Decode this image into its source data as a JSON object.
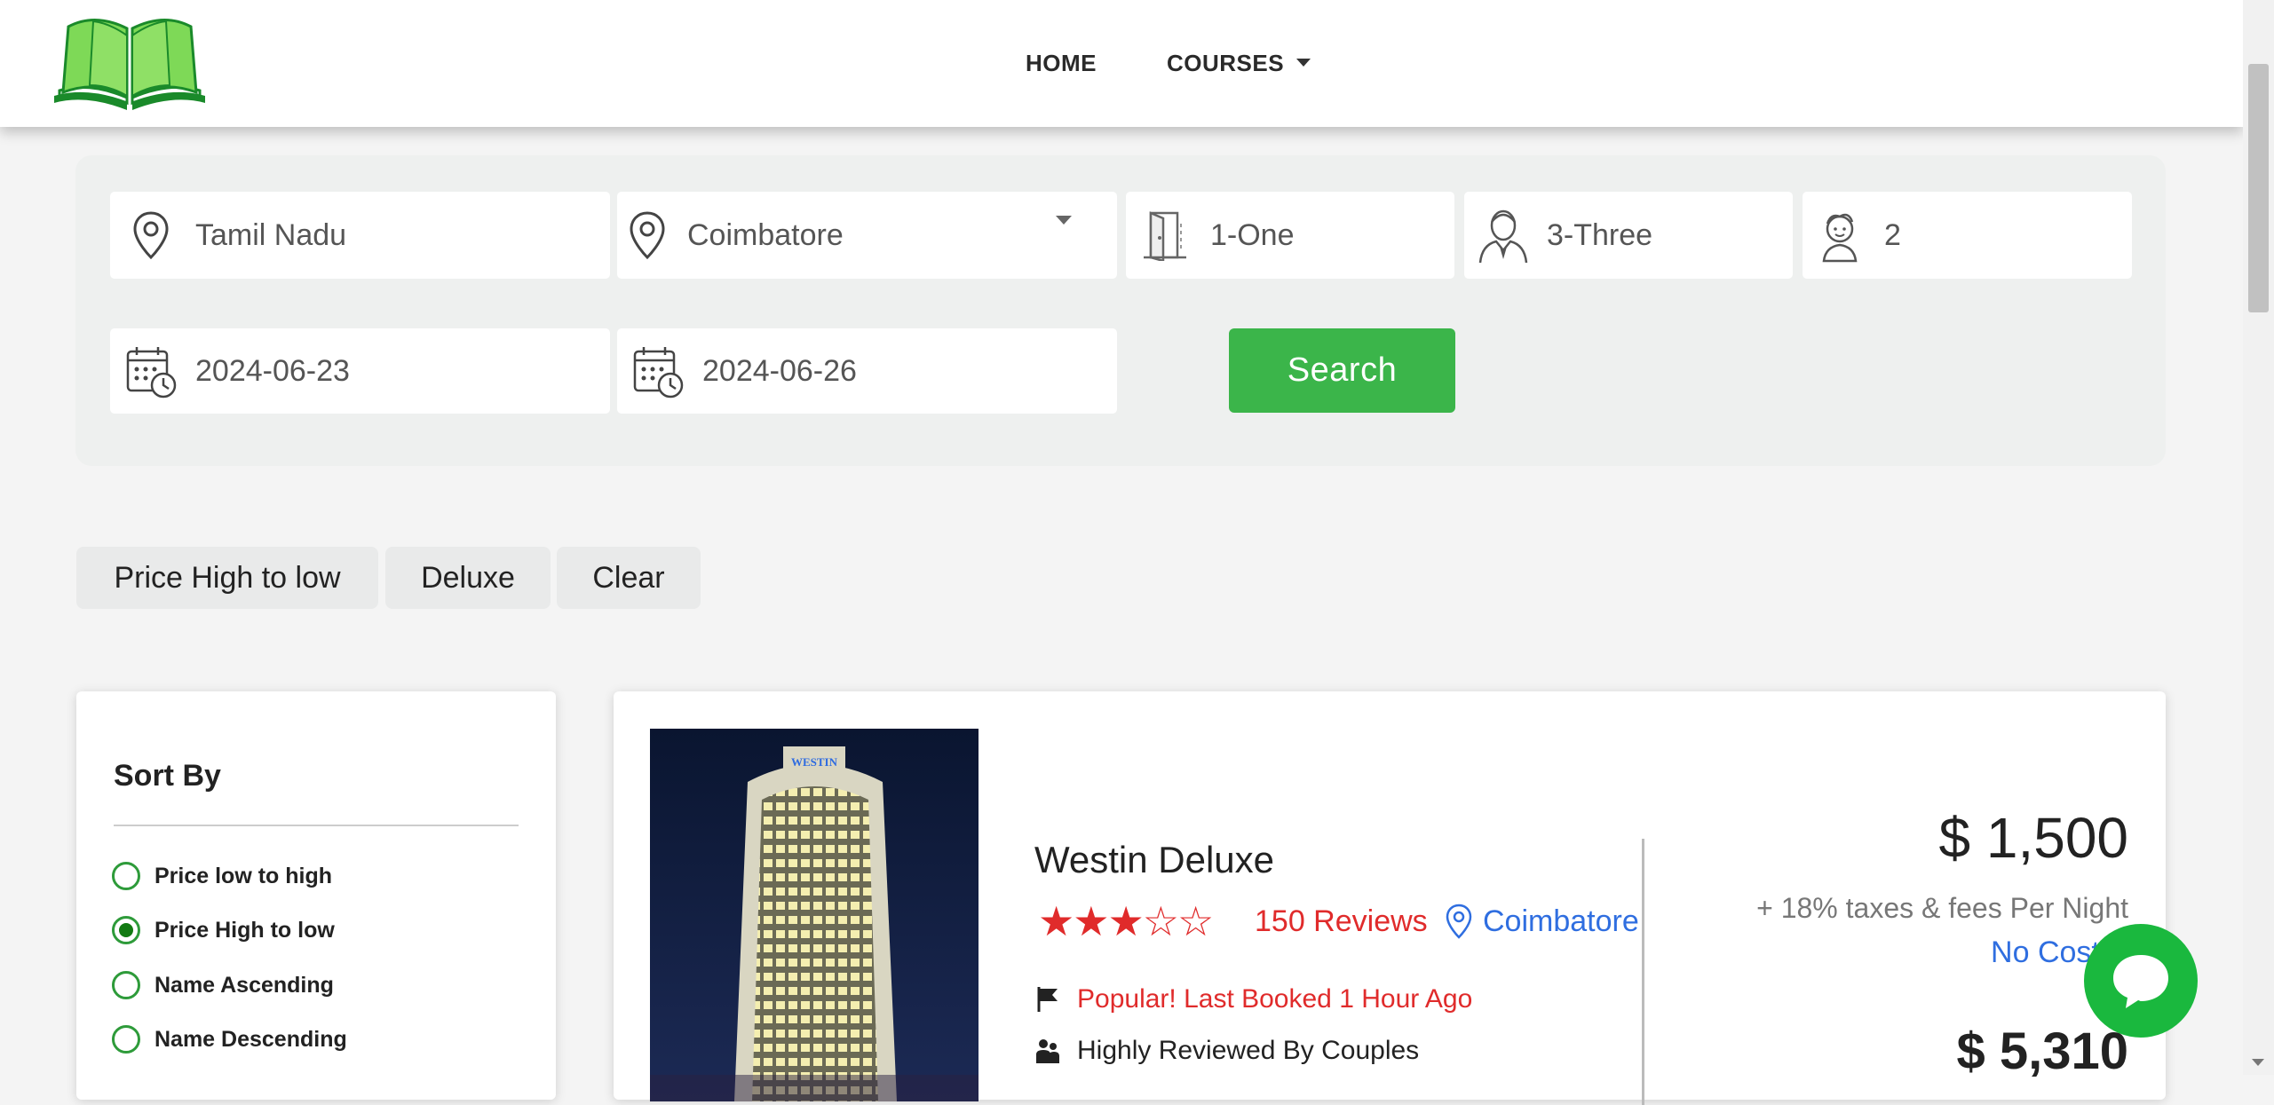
{
  "header": {
    "nav": {
      "home": "HOME",
      "courses": "COURSES"
    }
  },
  "search": {
    "state": "Tamil Nadu",
    "city": "Coimbatore",
    "rooms": "1-One",
    "adults": "3-Three",
    "children": "2",
    "checkin": "2024-06-23",
    "checkout": "2024-06-26",
    "search_label": "Search"
  },
  "filters": {
    "chips": [
      "Price High to low",
      "Deluxe",
      "Clear"
    ]
  },
  "sort": {
    "title": "Sort By",
    "options": [
      {
        "label": "Price low to high",
        "checked": false
      },
      {
        "label": "Price High to low",
        "checked": true
      },
      {
        "label": "Name Ascending",
        "checked": false
      },
      {
        "label": "Name Descending",
        "checked": false
      }
    ]
  },
  "hotel": {
    "image_sign": "WESTIN",
    "name": "Westin Deluxe",
    "rating": 3,
    "rating_max": 5,
    "reviews": "150 Reviews",
    "location": "Coimbatore",
    "feature_1": "Popular! Last Booked 1 Hour Ago",
    "feature_2": "Highly Reviewed By Couples",
    "price": "$ 1,500",
    "taxes": "+ 18% taxes & fees Per Night",
    "no_cost": "No Cost E",
    "price_total": "$ 5,310"
  },
  "colors": {
    "brand_green": "#3bb54a",
    "accent_red": "#e02b2b",
    "link_blue": "#2f6ee0"
  }
}
